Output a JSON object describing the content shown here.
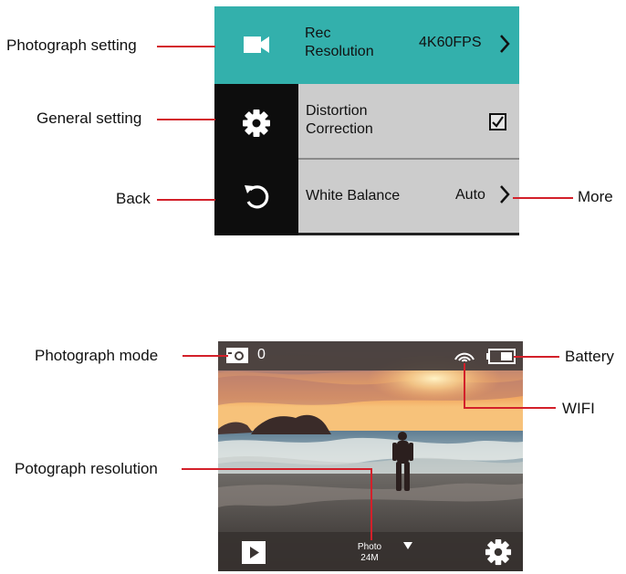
{
  "annotations": {
    "photograph_setting": "Photograph setting",
    "general_setting": "General setting",
    "back": "Back",
    "more": "More",
    "photograph_mode": "Photograph mode",
    "battery": "Battery",
    "wifi": "WIFI",
    "photograph_resolution": "Potograph resolution"
  },
  "menu": {
    "rows": [
      {
        "title_line1": "Rec",
        "title_line2": "Resolution",
        "value": "4K60FPS",
        "icon": "video-camera-icon"
      },
      {
        "title_line1": "Distortion",
        "title_line2": "Correction",
        "checked": true,
        "icon": "gear-icon"
      },
      {
        "title": "White Balance",
        "value": "Auto",
        "icon": "back-arrow-icon"
      }
    ],
    "colors": {
      "active_row": "#33b0ac",
      "inactive_row": "#cccccc",
      "sidebar": "#0d0d0d"
    }
  },
  "camera": {
    "mode_count": "0",
    "mode_label": "Photo",
    "resolution": "24M",
    "icons": [
      "photo-mode-icon",
      "wifi-icon",
      "battery-icon",
      "playback-icon",
      "dropdown-arrow-icon",
      "settings-gear-icon"
    ]
  },
  "colors": {
    "leader": "#d3202a"
  }
}
